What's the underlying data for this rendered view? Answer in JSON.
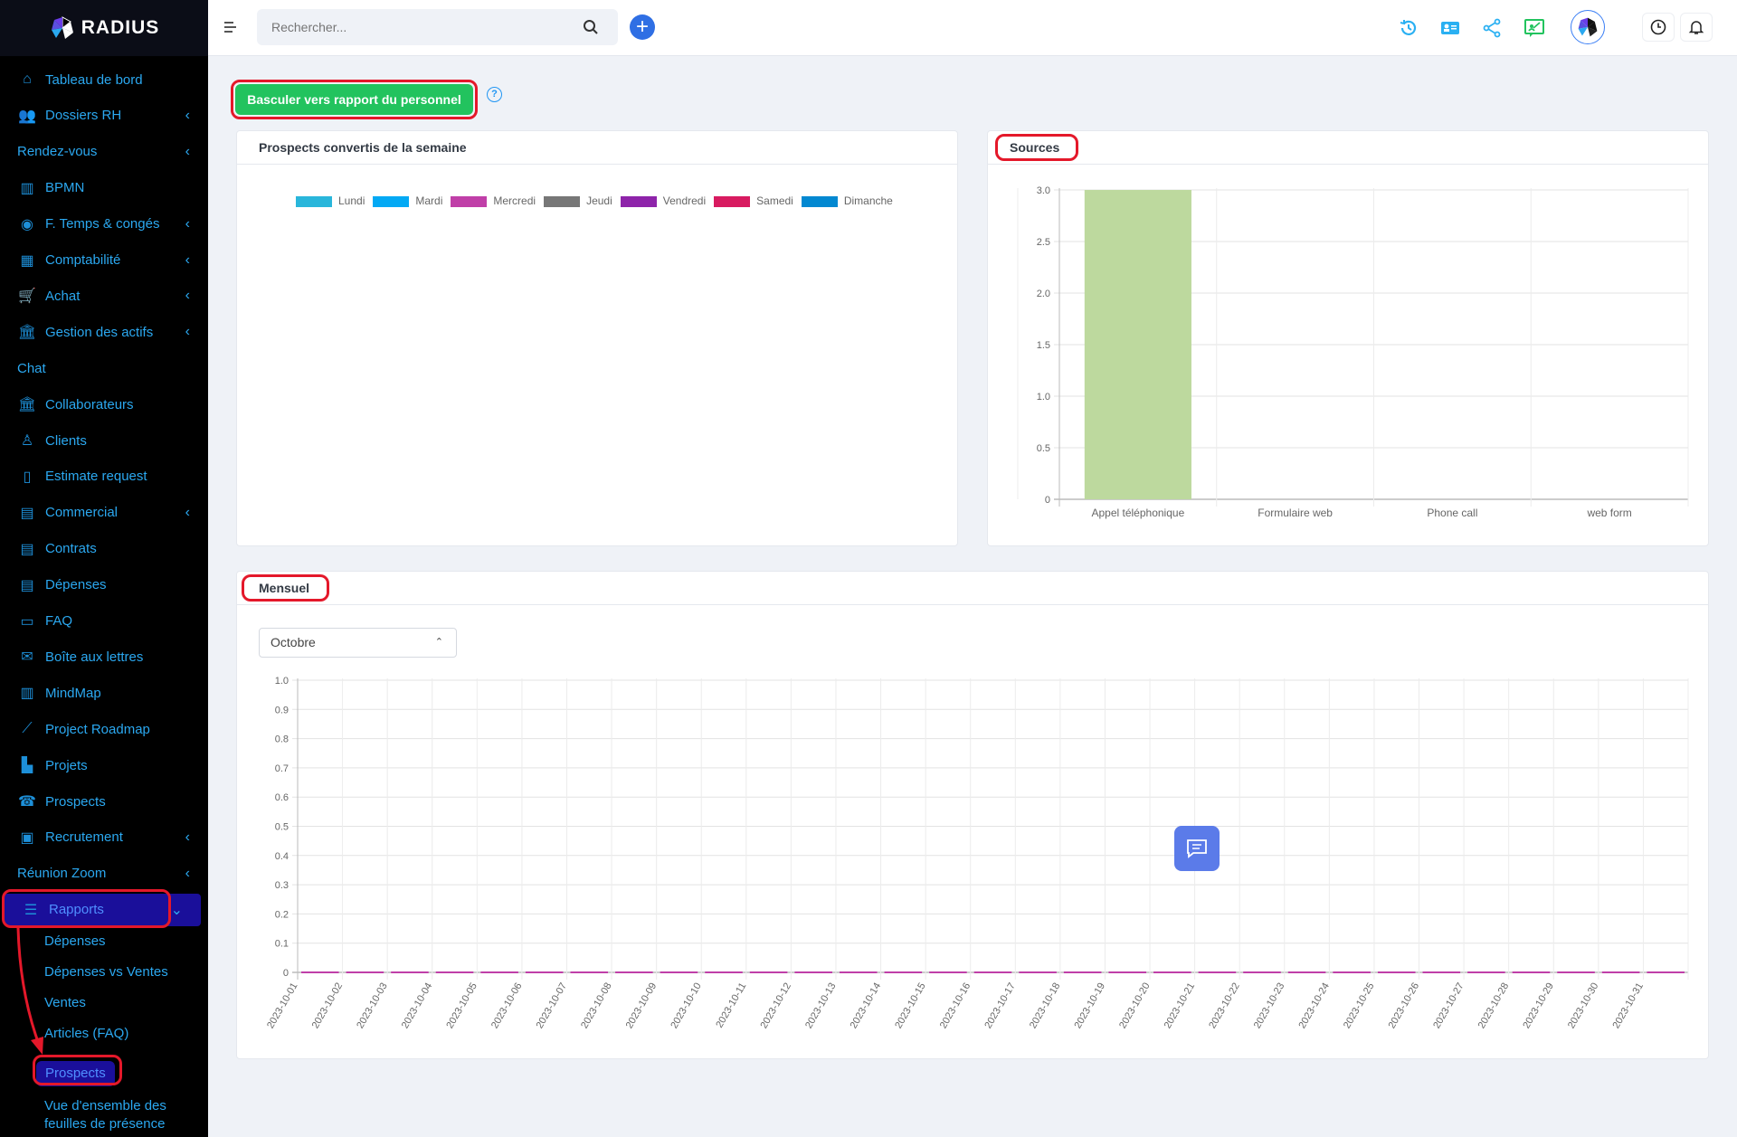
{
  "brand": "RADIUS",
  "sidebar": {
    "items": [
      {
        "label": "Tableau de bord",
        "icon": "home-icon",
        "chev": false
      },
      {
        "label": "Dossiers RH",
        "icon": "users-icon",
        "chev": true
      },
      {
        "label": "Rendez-vous",
        "icon": "",
        "chev": true
      },
      {
        "label": "BPMN",
        "icon": "map-icon",
        "chev": false
      },
      {
        "label": "F. Temps & congés",
        "icon": "user-circle-icon",
        "chev": true
      },
      {
        "label": "Comptabilité",
        "icon": "calculator-icon",
        "chev": true
      },
      {
        "label": "Achat",
        "icon": "cart-icon",
        "chev": true
      },
      {
        "label": "Gestion des actifs",
        "icon": "bank-icon",
        "chev": true
      },
      {
        "label": "Chat",
        "icon": "",
        "chev": false
      },
      {
        "label": "Collaborateurs",
        "icon": "bank-icon",
        "chev": false
      },
      {
        "label": "Clients",
        "icon": "user-icon",
        "chev": false
      },
      {
        "label": "Estimate request",
        "icon": "file-icon",
        "chev": false
      },
      {
        "label": "Commercial",
        "icon": "document-icon",
        "chev": true
      },
      {
        "label": "Contrats",
        "icon": "contract-icon",
        "chev": false
      },
      {
        "label": "Dépenses",
        "icon": "receipt-icon",
        "chev": false
      },
      {
        "label": "FAQ",
        "icon": "folder-icon",
        "chev": false
      },
      {
        "label": "Boîte aux lettres",
        "icon": "inbox-icon",
        "chev": false
      },
      {
        "label": "MindMap",
        "icon": "map-icon",
        "chev": false
      },
      {
        "label": "Project Roadmap",
        "icon": "line-chart-icon",
        "chev": false
      },
      {
        "label": "Projets",
        "icon": "bar-chart-icon",
        "chev": false
      },
      {
        "label": "Prospects",
        "icon": "phone-icon",
        "chev": false
      },
      {
        "label": "Recrutement",
        "icon": "id-badge-icon",
        "chev": true
      },
      {
        "label": "Réunion Zoom",
        "icon": "",
        "chev": true
      },
      {
        "label": "Rapports",
        "icon": "report-icon",
        "chev": "down",
        "active": true
      }
    ],
    "sub": [
      "Dépenses",
      "Dépenses vs Ventes",
      "Ventes",
      "Articles (FAQ)",
      "Prospects",
      "Vue d'ensemble des",
      "feuilles de présence"
    ],
    "sub_active": 4
  },
  "topbar": {
    "search_placeholder": "Rechercher...",
    "icons": [
      "history-icon",
      "contact-card-icon",
      "share-icon",
      "presentation-icon",
      "avatar",
      "clock-icon",
      "bell-icon"
    ]
  },
  "toggle_button": "Basculer vers rapport du personnel",
  "weekly": {
    "title": "Prospects convertis de la semaine",
    "legend": [
      {
        "name": "Lundi",
        "color": "#29b6db"
      },
      {
        "name": "Mardi",
        "color": "#03a9f4"
      },
      {
        "name": "Mercredi",
        "color": "#c03fa8"
      },
      {
        "name": "Jeudi",
        "color": "#777777"
      },
      {
        "name": "Vendredi",
        "color": "#8e24aa"
      },
      {
        "name": "Samedi",
        "color": "#d81b60"
      },
      {
        "name": "Dimanche",
        "color": "#0288d1"
      }
    ]
  },
  "sources": {
    "title": "Sources"
  },
  "monthly": {
    "title": "Mensuel",
    "month_select": "Octobre"
  },
  "chart_data": [
    {
      "type": "bar",
      "title": "Sources",
      "categories": [
        "Appel téléphonique",
        "Formulaire web",
        "Phone call",
        "web form"
      ],
      "values": [
        3,
        0,
        0,
        0
      ],
      "ylim": [
        0,
        3
      ],
      "yticks": [
        "0",
        "0.5",
        "1.0",
        "1.5",
        "2.0",
        "2.5",
        "3.0"
      ],
      "color": "#bdd99e",
      "grid": true
    },
    {
      "type": "line",
      "title": "Mensuel",
      "categories": [
        "2023-10-01",
        "2023-10-02",
        "2023-10-03",
        "2023-10-04",
        "2023-10-05",
        "2023-10-06",
        "2023-10-07",
        "2023-10-08",
        "2023-10-09",
        "2023-10-10",
        "2023-10-11",
        "2023-10-12",
        "2023-10-13",
        "2023-10-14",
        "2023-10-15",
        "2023-10-16",
        "2023-10-17",
        "2023-10-18",
        "2023-10-19",
        "2023-10-20",
        "2023-10-21",
        "2023-10-22",
        "2023-10-23",
        "2023-10-24",
        "2023-10-25",
        "2023-10-26",
        "2023-10-27",
        "2023-10-28",
        "2023-10-29",
        "2023-10-30",
        "2023-10-31"
      ],
      "values": [
        0,
        0,
        0,
        0,
        0,
        0,
        0,
        0,
        0,
        0,
        0,
        0,
        0,
        0,
        0,
        0,
        0,
        0,
        0,
        0,
        0,
        0,
        0,
        0,
        0,
        0,
        0,
        0,
        0,
        0,
        0
      ],
      "ylim": [
        0,
        1
      ],
      "yticks": [
        "0",
        "0.1",
        "0.2",
        "0.3",
        "0.4",
        "0.5",
        "0.6",
        "0.7",
        "0.8",
        "0.9",
        "1.0"
      ],
      "color": "#c03fa8",
      "grid": true
    }
  ]
}
